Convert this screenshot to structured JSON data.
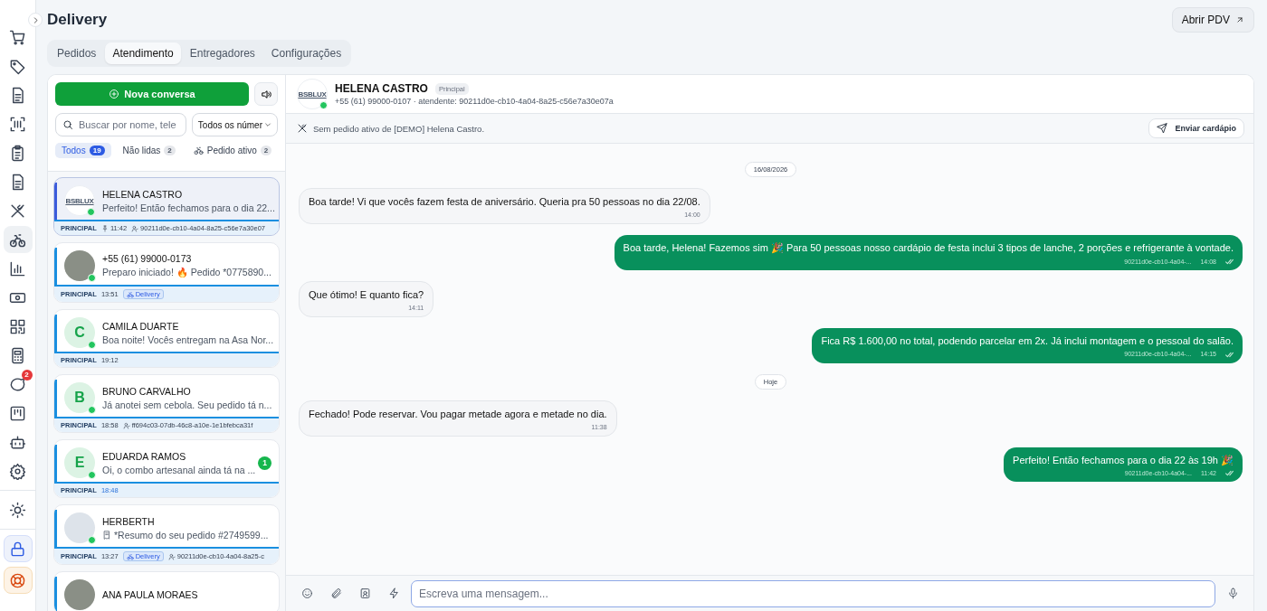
{
  "page": {
    "title": "Delivery",
    "open_pos_button": "Abrir PDV"
  },
  "sidebar": {
    "items": [
      {
        "selected": false
      },
      {
        "selected": false
      },
      {
        "selected": false
      },
      {
        "selected": false
      },
      {
        "selected": false
      },
      {
        "selected": false
      },
      {
        "selected": false
      },
      {
        "selected": true
      },
      {
        "selected": false
      },
      {
        "selected": false
      },
      {
        "selected": false
      },
      {
        "selected": false
      },
      {
        "selected": false,
        "badge": "2"
      },
      {
        "selected": false
      },
      {
        "selected": false
      },
      {
        "selected": false
      }
    ]
  },
  "tabs": [
    {
      "label": "Pedidos",
      "selected": false
    },
    {
      "label": "Atendimento",
      "selected": true
    },
    {
      "label": "Entregadores",
      "selected": false
    },
    {
      "label": "Configurações",
      "selected": false
    }
  ],
  "conversation_list": {
    "new_button": "Nova conversa",
    "search": {
      "placeholder": "Buscar por nome, tele"
    },
    "number_filter": "Todos os númer",
    "filters": [
      {
        "label": "Todos",
        "count": "19",
        "selected": true
      },
      {
        "label": "Não lidas",
        "count": "2",
        "selected": false
      },
      {
        "label": "Pedido ativo",
        "count": "2",
        "selected": false,
        "kind": "bike"
      }
    ],
    "conversations": [
      {
        "name": "HELENA CASTRO",
        "avatar": {
          "kind": "logo",
          "text": "BSBLUX"
        },
        "online": true,
        "preview": "Perfeito! Então fechamos para o dia 22...",
        "line": "PRINCIPAL",
        "pinned": true,
        "time": "11:42",
        "attendant": "90211d0e-cb10-4a04-8a25-c56e7a30e07",
        "selected": true
      },
      {
        "name": "+55 (61) 99000-0173",
        "avatar": {
          "kind": "photo"
        },
        "online": true,
        "preview": "Preparo iniciado! 🔥 Pedido *0775890...",
        "line": "PRINCIPAL",
        "pinned": false,
        "time": "13:51",
        "delivery": "Delivery",
        "selected": false
      },
      {
        "name": "CAMILA DUARTE",
        "avatar": {
          "kind": "initial",
          "text": "C"
        },
        "online": true,
        "preview": "Boa noite! Vocês entregam na Asa Nor...",
        "line": "PRINCIPAL",
        "pinned": false,
        "time": "19:12",
        "selected": false
      },
      {
        "name": "BRUNO CARVALHO",
        "avatar": {
          "kind": "initial",
          "text": "B"
        },
        "online": true,
        "preview": "Já anotei sem cebola. Seu pedido tá n...",
        "line": "PRINCIPAL",
        "pinned": false,
        "time": "18:58",
        "attendant": "ff694c03-07db-46c8-a10e-1e1bfebca31f",
        "selected": false
      },
      {
        "name": "EDUARDA RAMOS",
        "avatar": {
          "kind": "initial",
          "text": "E"
        },
        "online": true,
        "preview": "Oi, o combo artesanal ainda tá na ...",
        "unread": "1",
        "line": "PRINCIPAL",
        "pinned": false,
        "time": "18:48",
        "selected": false
      },
      {
        "name": "HERBERTH",
        "avatar": {
          "kind": "image"
        },
        "online": true,
        "preview": "*Resumo do seu pedido #2749599...",
        "receipt": true,
        "line": "PRINCIPAL",
        "pinned": false,
        "time": "13:27",
        "delivery": "Delivery",
        "attendant": "90211d0e-cb10-4a04-8a25-c",
        "selected": false
      },
      {
        "name": "ANA PAULA MORAES",
        "avatar": {
          "kind": "photo"
        },
        "selected": false
      }
    ]
  },
  "chat": {
    "contact": {
      "name": "HELENA CASTRO",
      "badge": "Principal",
      "avatar": {
        "kind": "logo",
        "text": "BSBLUX"
      },
      "online": true,
      "subtitle": "+55 (61) 99000-0107 · atendente: 90211d0e-cb10-4a04-8a25-c56e7a30e07a"
    },
    "notice": "Sem pedido ativo de [DEMO] Helena Castro.",
    "send_menu_button": "Enviar cardápio",
    "messages": [
      {
        "kind": "date",
        "text": "16/08/2026"
      },
      {
        "kind": "in",
        "text": "Boa tarde! Vi que vocês fazem festa de aniversário. Queria pra 50 pessoas no dia 22/08.",
        "time": "14:00"
      },
      {
        "kind": "out",
        "text": "Boa tarde, Helena! Fazemos sim 🎉 Para 50 pessoas nosso cardápio de festa inclui 3 tipos de lanche, 2 porções e refrigerante à vontade.",
        "attendant": "90211d0e-cb10-4a04-...",
        "time": "14:08"
      },
      {
        "kind": "in",
        "text": "Que ótimo! E quanto fica?",
        "time": "14:11"
      },
      {
        "kind": "out",
        "text": "Fica R$ 1.600,00 no total, podendo parcelar em 2x. Já inclui montagem e o pessoal do salão.",
        "attendant": "90211d0e-cb10-4a04-...",
        "time": "14:15"
      },
      {
        "kind": "date",
        "text": "Hoje"
      },
      {
        "kind": "in",
        "text": "Fechado! Pode reservar. Vou pagar metade agora e metade no dia.",
        "time": "11:38"
      },
      {
        "kind": "out",
        "text": "Perfeito! Então fechamos para o dia 22 às 19h 🎉",
        "attendant": "90211d0e-cb10-4a04-...",
        "time": "11:42"
      }
    ],
    "composer": {
      "placeholder": "Escreva uma mensagem..."
    }
  }
}
